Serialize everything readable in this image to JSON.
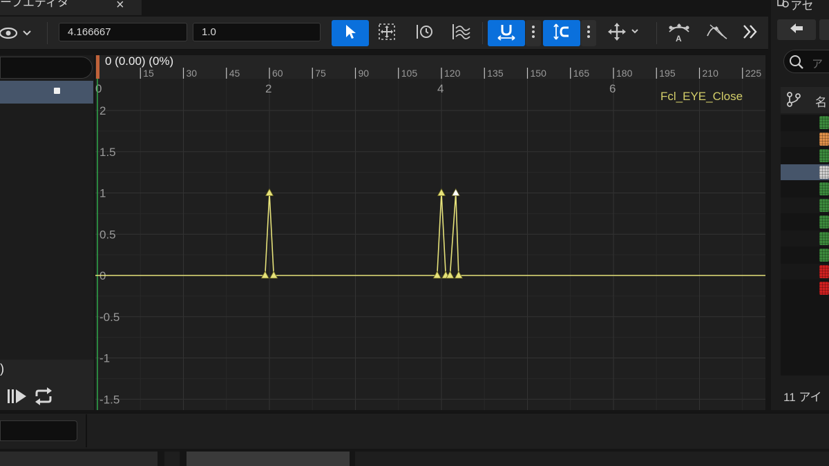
{
  "tab": {
    "title": "ーブエディタ",
    "close": "×"
  },
  "toolbar": {
    "time_value": "4.166667",
    "value_field": "1.0"
  },
  "curve_editor": {
    "frame_readout": "0 (0.00) (0%)",
    "curve_name": "Fcl_EYE_Close",
    "colors": {
      "curve": "#e6e27a",
      "key_selected": "#ffffff",
      "playhead_end": "#b02a2a",
      "start_line": "#2fa84a"
    }
  },
  "chart_data": {
    "type": "line",
    "title": "",
    "series": [
      {
        "name": "Fcl_EYE_Close",
        "x": [
          0,
          1.95,
          2.0,
          2.05,
          3.95,
          4.0,
          4.05,
          4.1,
          4.166667,
          4.2,
          8
        ],
        "y": [
          0,
          0,
          1,
          0,
          0,
          1,
          0,
          0,
          1,
          0,
          0
        ]
      }
    ],
    "xlabel": "",
    "ylabel": "",
    "xlim": [
      0,
      8.8
    ],
    "ylim": [
      -1.6,
      2.2
    ],
    "x_ticks": [
      "0",
      "2",
      "4",
      "6"
    ],
    "y_ticks": [
      "2",
      "1.5",
      "1",
      "0.5",
      "0",
      "-0.5",
      "-1",
      "-1.5"
    ],
    "frame_ruler": [
      "0",
      "15",
      "30",
      "45",
      "60",
      "75",
      "90",
      "105",
      "120",
      "135",
      "150",
      "165",
      "180",
      "195",
      "210",
      "225"
    ],
    "grid": true
  },
  "right_panel": {
    "tab_label": "アセ",
    "search_placeholder": "ア",
    "column_name": "名",
    "item_count": "11 アイ",
    "asset_colors": [
      "#3c8a3c",
      "#e0904a",
      "#3c8a3c",
      "#d0d0d0",
      "#3c8a3c",
      "#3c8a3c",
      "#3c8a3c",
      "#3c8a3c",
      "#3c8a3c",
      "#d02020",
      "#d02020"
    ]
  },
  "left_panel": {
    "paren": ")"
  }
}
